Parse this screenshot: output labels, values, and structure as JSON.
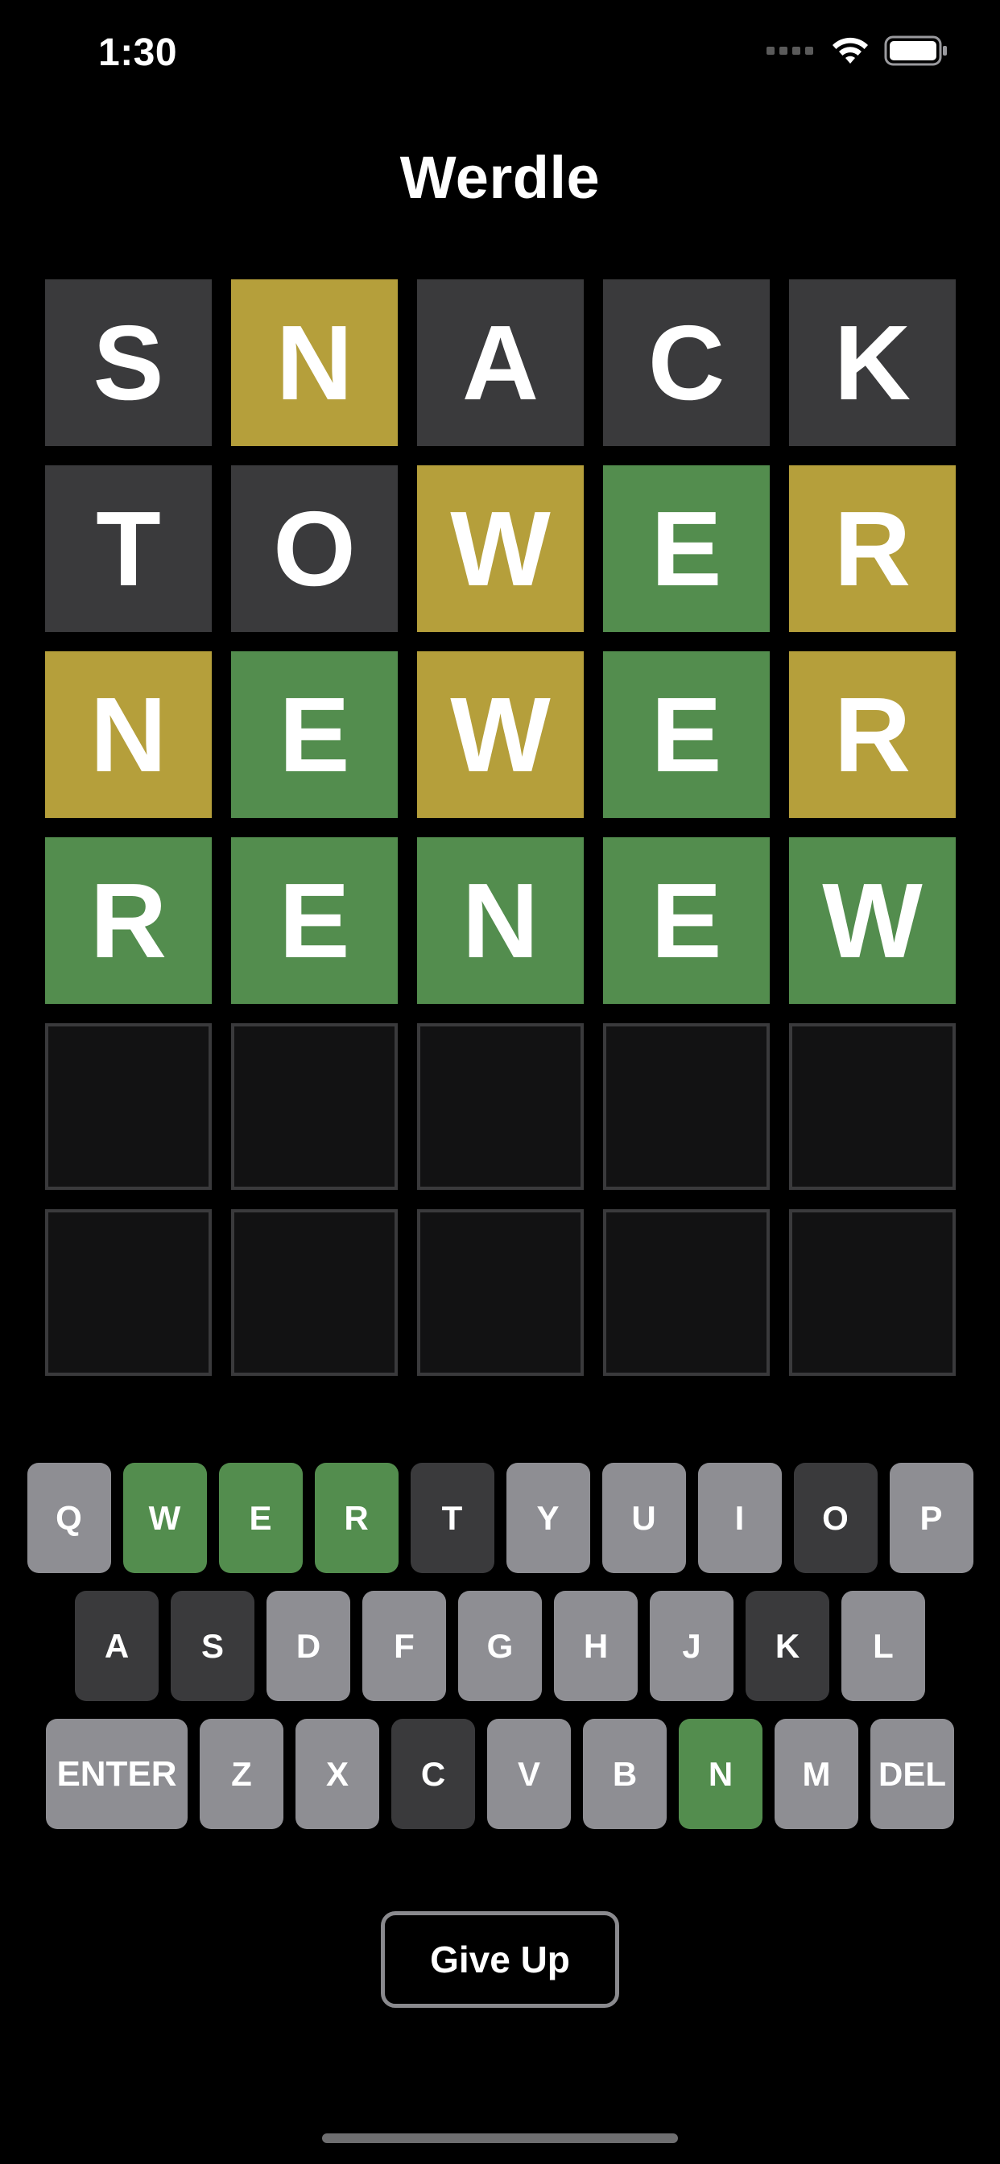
{
  "status_bar": {
    "time": "1:30"
  },
  "app": {
    "title": "Werdle"
  },
  "colors": {
    "absent": "#3a3a3c",
    "present": "#b59f3b",
    "correct": "#538d4e",
    "unused_key": "#8e8e93",
    "empty_tile": "#121213"
  },
  "board": {
    "rows": [
      [
        {
          "letter": "S",
          "state": "absent"
        },
        {
          "letter": "N",
          "state": "present"
        },
        {
          "letter": "A",
          "state": "absent"
        },
        {
          "letter": "C",
          "state": "absent"
        },
        {
          "letter": "K",
          "state": "absent"
        }
      ],
      [
        {
          "letter": "T",
          "state": "absent"
        },
        {
          "letter": "O",
          "state": "absent"
        },
        {
          "letter": "W",
          "state": "present"
        },
        {
          "letter": "E",
          "state": "correct"
        },
        {
          "letter": "R",
          "state": "present"
        }
      ],
      [
        {
          "letter": "N",
          "state": "present"
        },
        {
          "letter": "E",
          "state": "correct"
        },
        {
          "letter": "W",
          "state": "present"
        },
        {
          "letter": "E",
          "state": "correct"
        },
        {
          "letter": "R",
          "state": "present"
        }
      ],
      [
        {
          "letter": "R",
          "state": "correct"
        },
        {
          "letter": "E",
          "state": "correct"
        },
        {
          "letter": "N",
          "state": "correct"
        },
        {
          "letter": "E",
          "state": "correct"
        },
        {
          "letter": "W",
          "state": "correct"
        }
      ],
      [
        {
          "letter": "",
          "state": "empty"
        },
        {
          "letter": "",
          "state": "empty"
        },
        {
          "letter": "",
          "state": "empty"
        },
        {
          "letter": "",
          "state": "empty"
        },
        {
          "letter": "",
          "state": "empty"
        }
      ],
      [
        {
          "letter": "",
          "state": "empty"
        },
        {
          "letter": "",
          "state": "empty"
        },
        {
          "letter": "",
          "state": "empty"
        },
        {
          "letter": "",
          "state": "empty"
        },
        {
          "letter": "",
          "state": "empty"
        }
      ]
    ]
  },
  "keyboard": {
    "rows": [
      [
        {
          "label": "Q",
          "state": "unused"
        },
        {
          "label": "W",
          "state": "correct"
        },
        {
          "label": "E",
          "state": "correct"
        },
        {
          "label": "R",
          "state": "correct"
        },
        {
          "label": "T",
          "state": "absent"
        },
        {
          "label": "Y",
          "state": "unused"
        },
        {
          "label": "U",
          "state": "unused"
        },
        {
          "label": "I",
          "state": "unused"
        },
        {
          "label": "O",
          "state": "absent"
        },
        {
          "label": "P",
          "state": "unused"
        }
      ],
      [
        {
          "label": "A",
          "state": "absent"
        },
        {
          "label": "S",
          "state": "absent"
        },
        {
          "label": "D",
          "state": "unused"
        },
        {
          "label": "F",
          "state": "unused"
        },
        {
          "label": "G",
          "state": "unused"
        },
        {
          "label": "H",
          "state": "unused"
        },
        {
          "label": "J",
          "state": "unused"
        },
        {
          "label": "K",
          "state": "absent"
        },
        {
          "label": "L",
          "state": "unused"
        }
      ],
      [
        {
          "label": "ENTER",
          "state": "unused",
          "wide": true
        },
        {
          "label": "Z",
          "state": "unused"
        },
        {
          "label": "X",
          "state": "unused"
        },
        {
          "label": "C",
          "state": "absent"
        },
        {
          "label": "V",
          "state": "unused"
        },
        {
          "label": "B",
          "state": "unused"
        },
        {
          "label": "N",
          "state": "correct"
        },
        {
          "label": "M",
          "state": "unused"
        },
        {
          "label": "DEL",
          "state": "unused"
        }
      ]
    ]
  },
  "actions": {
    "give_up_label": "Give Up"
  }
}
